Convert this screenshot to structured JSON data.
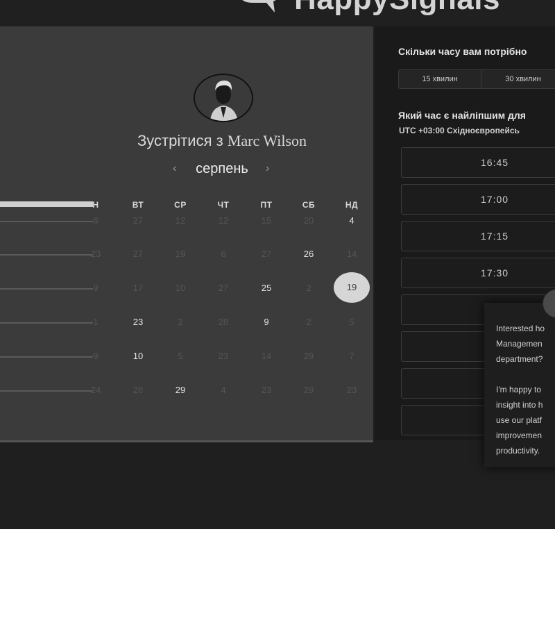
{
  "brand": {
    "logo_text": "HappySignals"
  },
  "meeting": {
    "title_prefix": "Зустрітися з",
    "host_name": "Marc Wilson"
  },
  "calendar": {
    "month": "серпень",
    "prev_label": "‹",
    "next_label": "›",
    "weekdays": [
      "Н",
      "ВТ",
      "СР",
      "ЧТ",
      "ПТ",
      "СБ",
      "НД"
    ],
    "rows": [
      [
        "6",
        "27",
        "12",
        "12",
        "15",
        "20",
        "4"
      ],
      [
        "23",
        "27",
        "19",
        "6",
        "27",
        "26",
        "14"
      ],
      [
        "9",
        "17",
        "10",
        "27",
        "25",
        "2",
        "19"
      ],
      [
        "1",
        "23",
        "2",
        "28",
        "9",
        "2",
        "5"
      ],
      [
        "9",
        "10",
        "5",
        "23",
        "14",
        "29",
        "7"
      ],
      [
        "24",
        "28",
        "29",
        "4",
        "23",
        "29",
        "23"
      ]
    ],
    "active_days": [
      [
        false,
        false,
        false,
        false,
        false,
        false,
        true
      ],
      [
        false,
        false,
        false,
        false,
        false,
        true,
        false
      ],
      [
        false,
        false,
        false,
        false,
        true,
        false,
        false
      ],
      [
        false,
        true,
        false,
        false,
        true,
        false,
        false
      ],
      [
        false,
        true,
        false,
        false,
        false,
        false,
        false
      ],
      [
        false,
        false,
        true,
        false,
        false,
        false,
        false
      ]
    ],
    "selected_day": "19"
  },
  "booking": {
    "duration_question": "Скільки часу вам потрібно",
    "durations": [
      "15 хвилин",
      "30 хвилин"
    ],
    "time_question": "Який час є найліпшим для",
    "timezone": "UTC +03:00 Східноєвропейсь",
    "slots": [
      "16:45",
      "17:00",
      "17:15",
      "17:30",
      "",
      "",
      "",
      ""
    ]
  },
  "chat": {
    "message": "Interested ho\nManagemen\ndepartment?\n\nI'm happy to\ninsight into h\nuse our platf\nimprovemen\nproductivity."
  }
}
